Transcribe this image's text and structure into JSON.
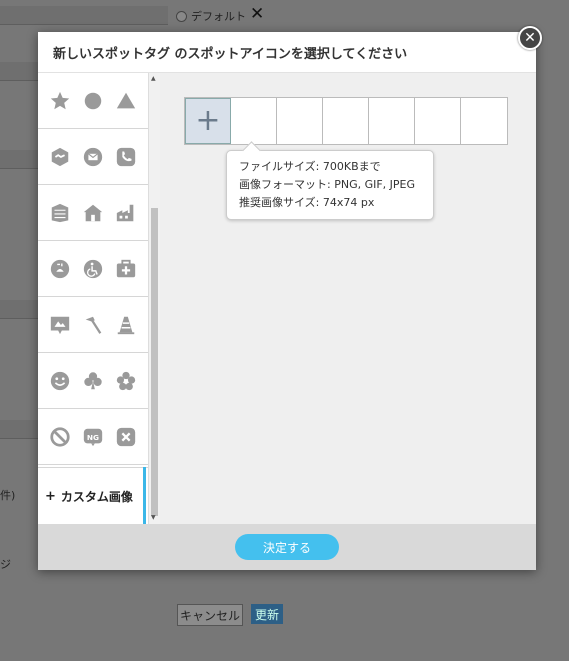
{
  "background": {
    "default_label": "デフォルト",
    "close_symbol": "✕",
    "left_label_1": "件)",
    "left_label_2": "ジ",
    "cancel_label": "キャンセル",
    "update_label": "更新"
  },
  "modal": {
    "title": "新しいスポットタグ のスポットアイコンを選択してください",
    "close_symbol": "✕",
    "sidebar": {
      "icon_rows": [
        [
          "star-icon",
          "circle-icon",
          "triangle-icon"
        ],
        [
          "handshake-icon",
          "mail-icon",
          "phone-icon"
        ],
        [
          "building-icon",
          "house-icon",
          "factory-icon"
        ],
        [
          "shower-icon",
          "wheelchair-icon",
          "first-aid-icon"
        ],
        [
          "signboard-icon",
          "hammer-icon",
          "traffic-cone-icon"
        ],
        [
          "smiley-icon",
          "club-icon",
          "flower-icon"
        ],
        [
          "no-entry-icon",
          "ng-icon",
          "x-box-icon"
        ]
      ],
      "custom_image_label": "カスタム画像",
      "custom_image_prefix": "+"
    },
    "slots": {
      "add_symbol": "+",
      "count": 7
    },
    "tooltip": {
      "line1": "ファイルサイズ: 700KBまで",
      "line2": "画像フォーマット: PNG, GIF, JPEG",
      "line3": "推奨画像サイズ: 74x74 px"
    },
    "ok_label": "決定する"
  },
  "colors": {
    "accent": "#44c0ee",
    "icon_gray": "#9a9a9a"
  }
}
